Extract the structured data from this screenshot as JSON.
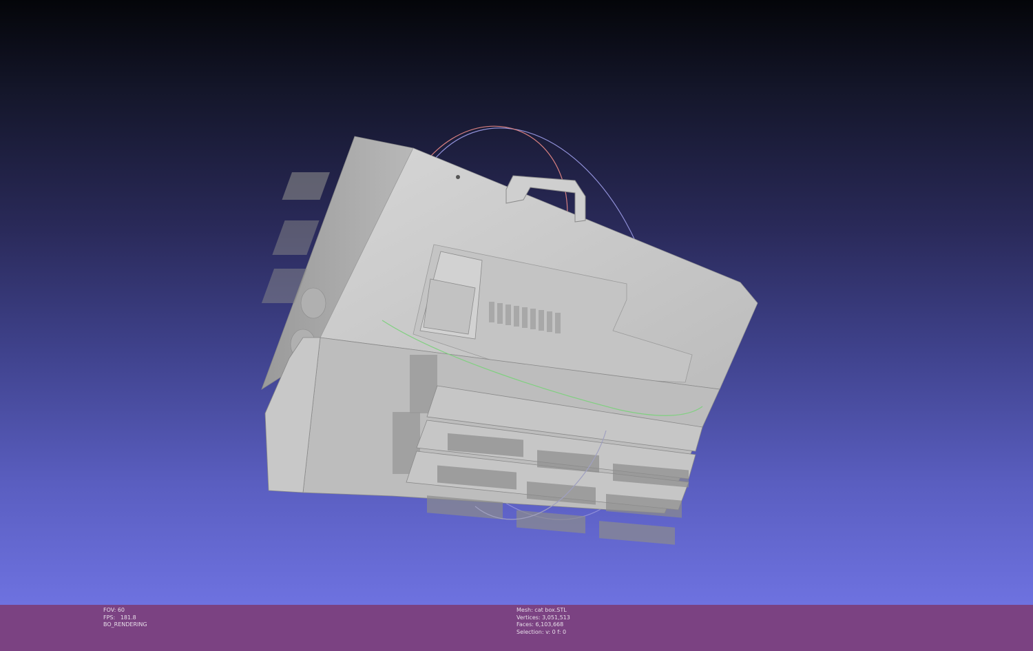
{
  "viewport": {
    "background_top": "#040509",
    "background_bottom": "#6e72e0",
    "model_color": "#c9c9c9",
    "trackball_colors": {
      "x_axis": "#d98080",
      "y_axis": "#80d080",
      "z_axis": "#9090d8"
    }
  },
  "status": {
    "left": {
      "fov": "FOV: 60",
      "fps": "FPS:   181.8",
      "mode": "BO_RENDERING"
    },
    "right": {
      "mesh": "Mesh: cat box.STL",
      "vertices": "Vertices: 3,051,513",
      "faces": "Faces: 6,103,668",
      "selection": "Selection: v: 0 f: 0"
    },
    "bar_color": "#7b4282"
  }
}
